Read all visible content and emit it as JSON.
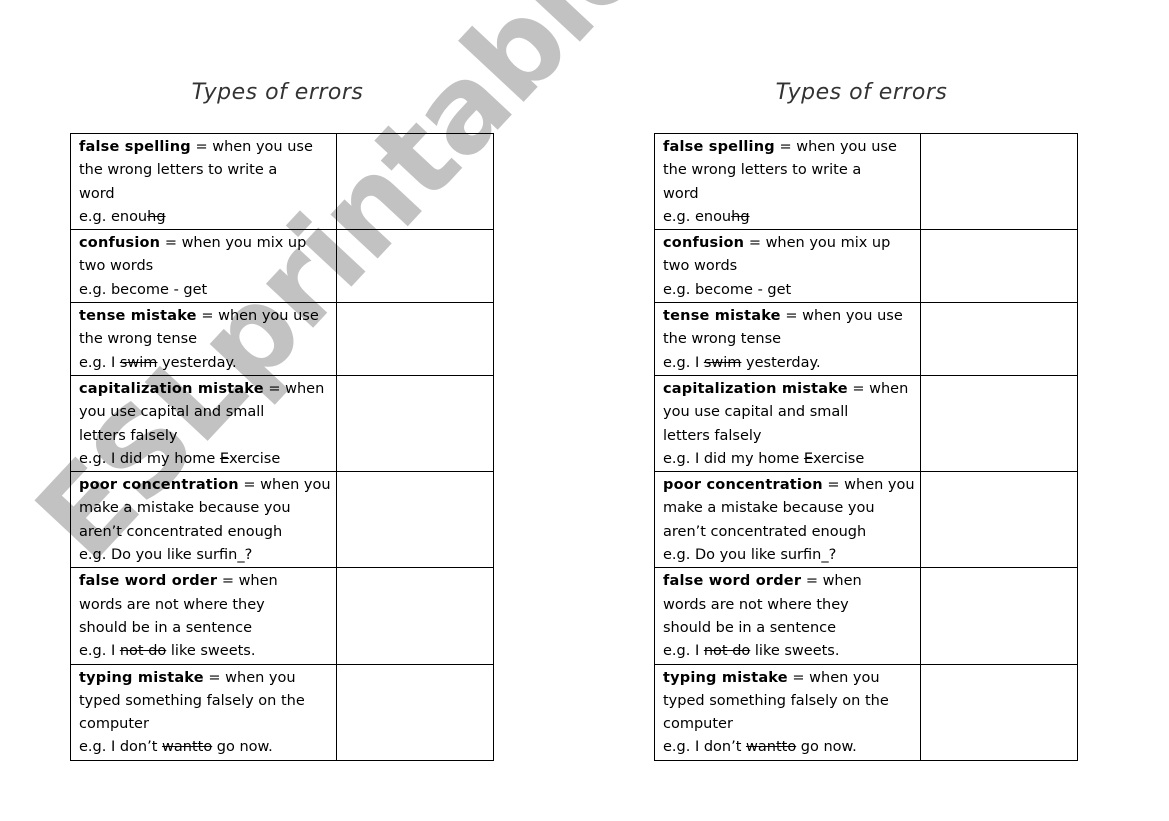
{
  "title": "Types of errors",
  "watermark": "ESLprintables.com",
  "rows": [
    {
      "term": "false spelling",
      "lines": [
        "= when you use",
        "the wrong letters to write a",
        "word"
      ],
      "example": {
        "prefix": "e.g. enou",
        "struck": "hg",
        "suffix": ""
      }
    },
    {
      "term": "confusion",
      "lines": [
        "= when you mix up",
        "two words"
      ],
      "example": {
        "prefix": "e.g. become - get",
        "struck": "",
        "suffix": ""
      }
    },
    {
      "term": "tense mistake",
      "lines": [
        "= when you use",
        "the wrong tense"
      ],
      "example": {
        "prefix": "e.g. I ",
        "struck": "swim",
        "suffix": " yesterday."
      }
    },
    {
      "term": "capitalization mistake",
      "lines": [
        "= when",
        "you use capital and small",
        "letters falsely"
      ],
      "example": {
        "prefix": "e.g. I did my home ",
        "struck": "E",
        "suffix": "xercise"
      }
    },
    {
      "term": "poor concentration",
      "lines": [
        "= when you",
        "make a mistake because you",
        "aren’t concentrated enough"
      ],
      "example": {
        "prefix": "e.g. Do you like surfin_?",
        "struck": "",
        "suffix": ""
      }
    },
    {
      "term": "false word order",
      "lines": [
        "= when",
        "words are not where they",
        "should be in a sentence"
      ],
      "example": {
        "prefix": "e.g. I ",
        "struck": "not do",
        "suffix": " like sweets."
      }
    },
    {
      "term": "typing mistake",
      "lines": [
        "= when you",
        "typed something falsely on the",
        "computer"
      ],
      "example": {
        "prefix": "e.g. I don’t ",
        "struck": "wantto",
        "suffix": " go now."
      }
    }
  ]
}
